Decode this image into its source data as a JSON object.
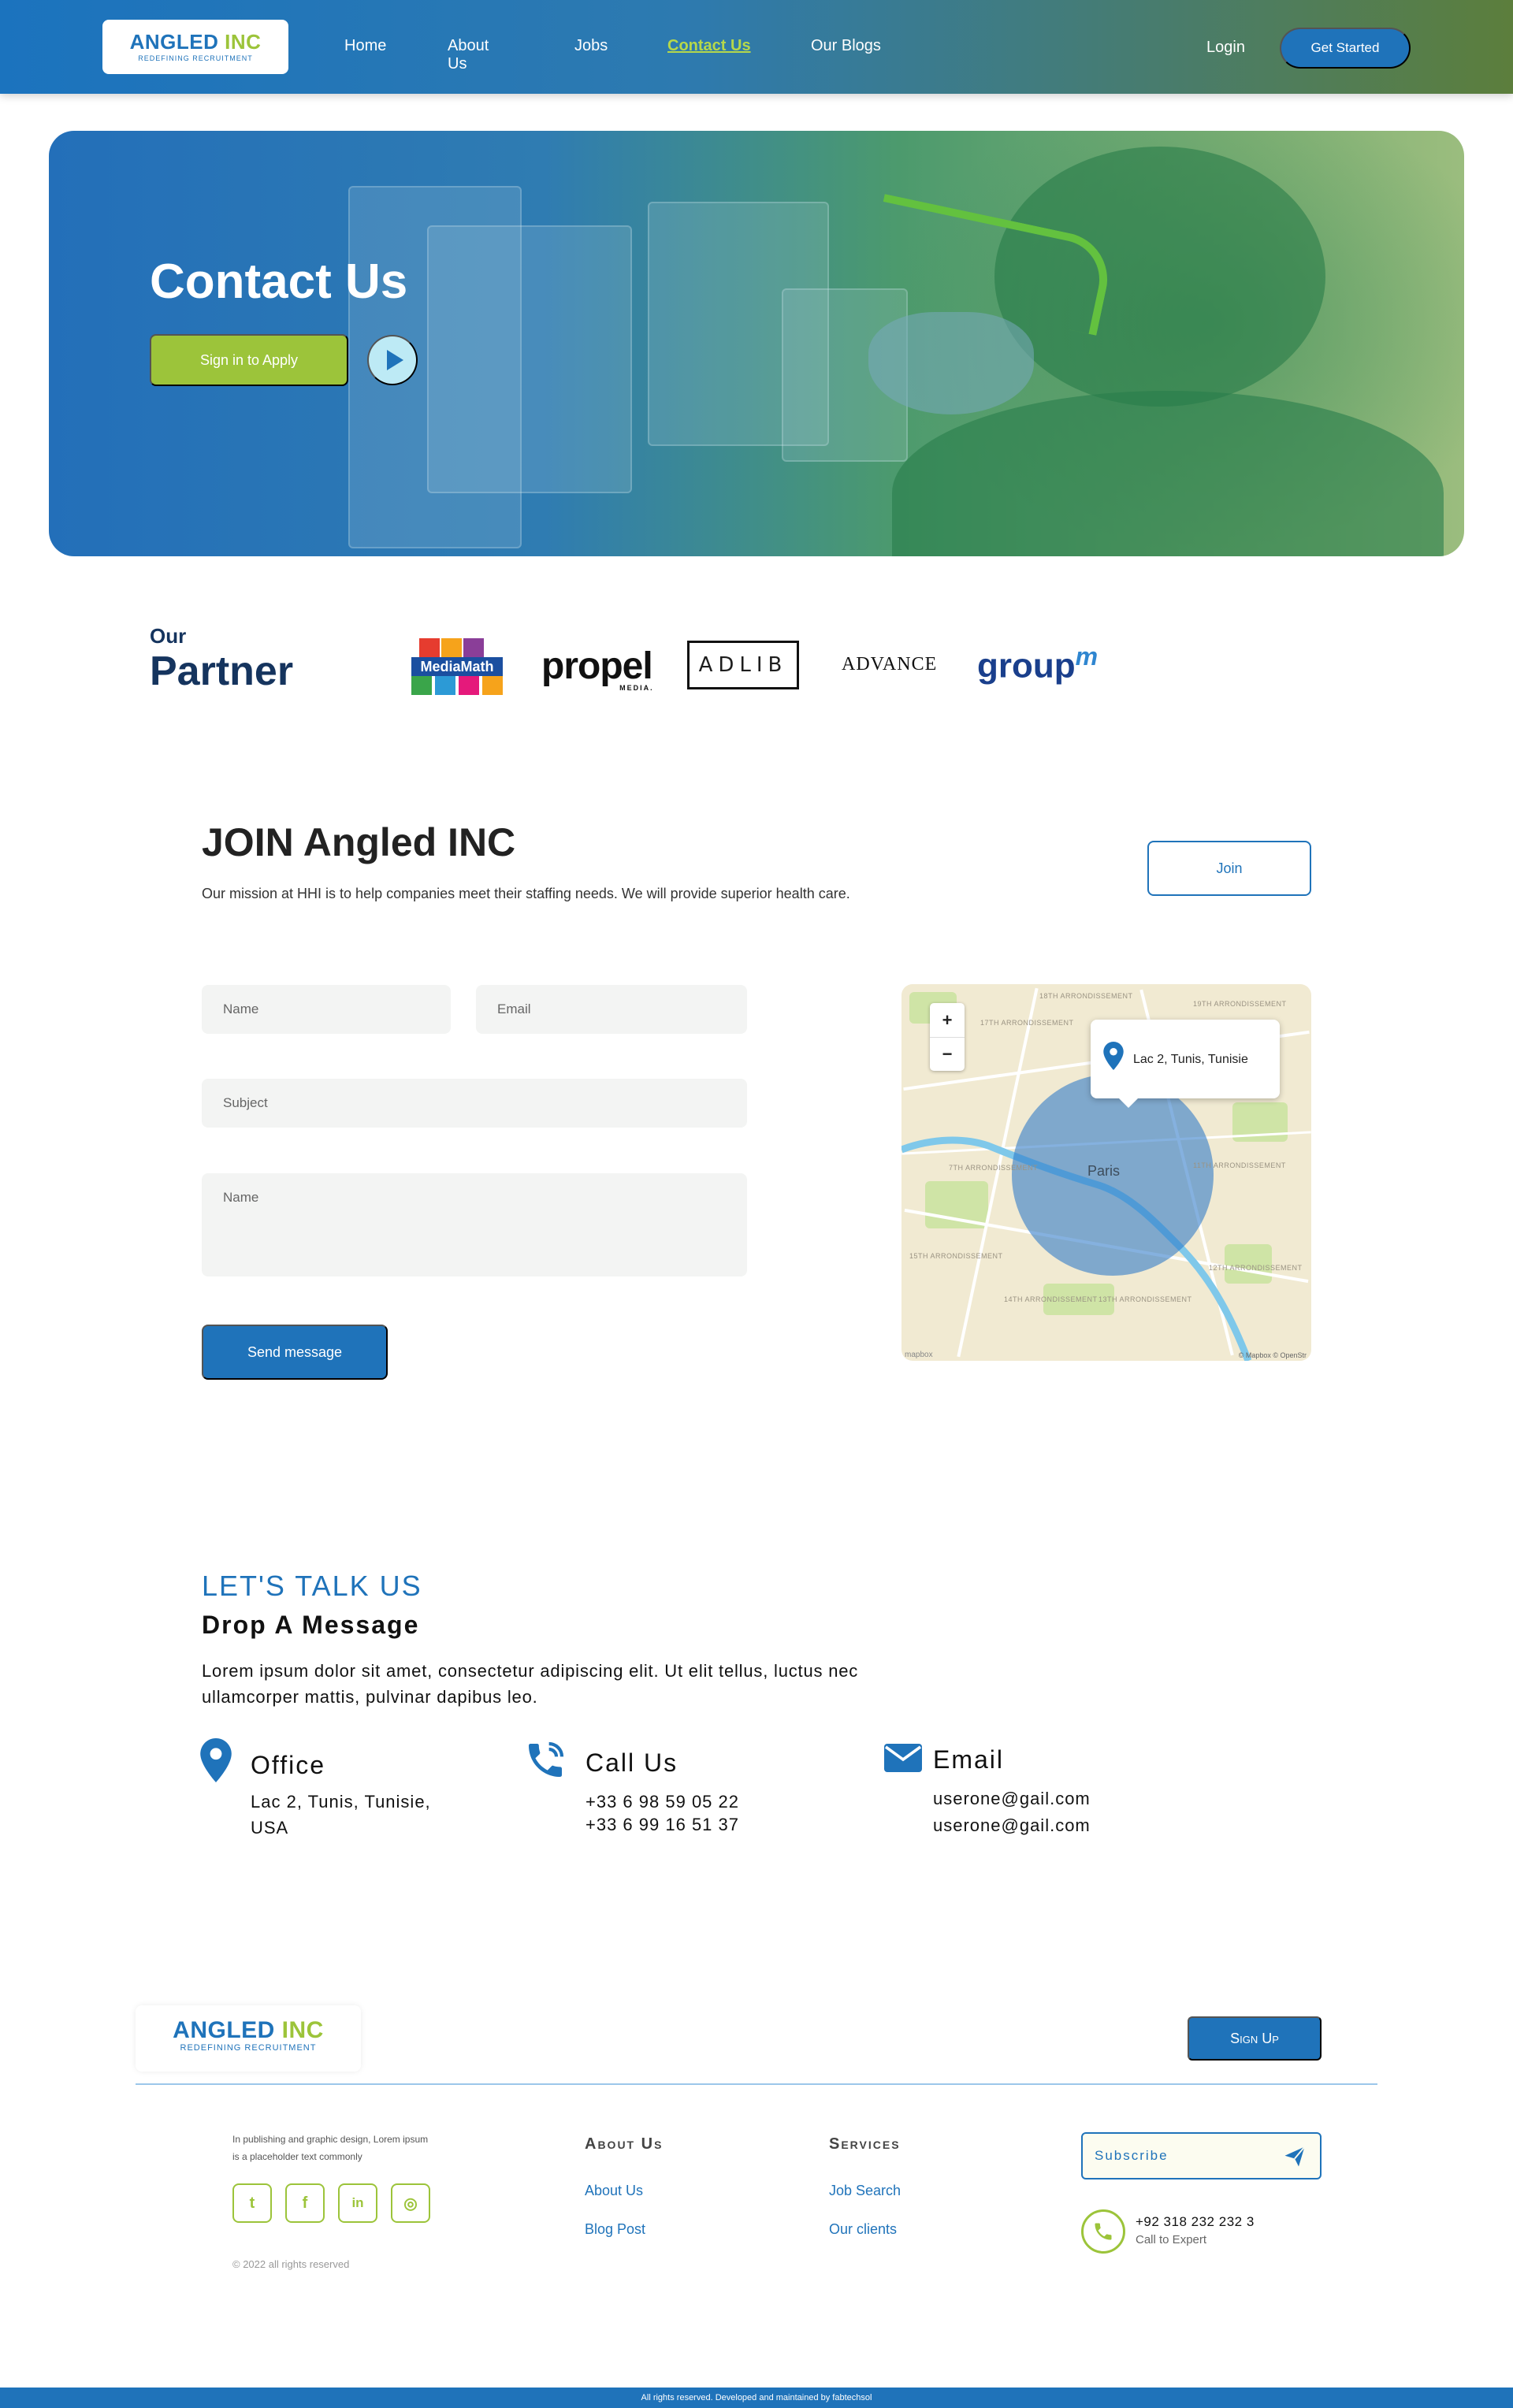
{
  "brand": {
    "name_main": "ANGLED",
    "name_accent": "INC",
    "tagline": "REDEFINING RECRUITMENT"
  },
  "nav": {
    "links": [
      {
        "label": "Home",
        "active": false
      },
      {
        "label": "About Us",
        "active": false
      },
      {
        "label": "Jobs",
        "active": false
      },
      {
        "label": "Contact Us",
        "active": true
      },
      {
        "label": "Our Blogs",
        "active": false
      }
    ],
    "login": "Login",
    "cta": "Get Started"
  },
  "hero": {
    "title": "Contact Us",
    "button": "Sign in to Apply",
    "play_icon": "play-icon"
  },
  "partners": {
    "kicker": "Our",
    "title": "Partner",
    "logos": {
      "mediamath": "MediaMath",
      "propel": "propel",
      "propel_sub": "MEDIA.",
      "adlib": "ADLIB",
      "advance": "ADVANCE",
      "groupm": "group",
      "groupm_sup": "m"
    }
  },
  "join": {
    "title": "JOIN Angled INC",
    "description": "Our mission at HHI is to help companies meet their staffing needs. We will provide superior health care.",
    "button": "Join",
    "form": {
      "name_placeholder": "Name",
      "email_placeholder": "Email",
      "subject_placeholder": "Subject",
      "message_placeholder": "Name",
      "submit": "Send message"
    }
  },
  "map": {
    "city": "Paris",
    "popup_address": "Lac 2, Tunis, Tunisie",
    "zoom_in": "+",
    "zoom_out": "−",
    "attribution": "© Mapbox © OpenStr",
    "brand": "mapbox",
    "districts": [
      "18TH ARRONDISSEMENT",
      "17TH ARRONDISSEMENT",
      "19TH ARRONDISSEMENT",
      "7TH ARRONDISSEMENT",
      "11TH ARRONDISSEMENT",
      "15TH ARRONDISSEMENT",
      "14TH ARRONDISSEMENT",
      "13TH ARRONDISSEMENT",
      "12TH ARRONDISSEMENT"
    ],
    "colors": {
      "land": "#f1ead2",
      "water": "#7fc8ea",
      "park": "#cfe4a6",
      "radius": "#2c78c8"
    }
  },
  "talk": {
    "kicker": "LET'S TALK US",
    "title": "Drop A Message",
    "description": "Lorem ipsum dolor sit amet, consectetur adipiscing elit. Ut elit tellus, luctus nec ullamcorper mattis, pulvinar dapibus leo.",
    "office": {
      "title": "Office",
      "line1": "Lac 2, Tunis, Tunisie,",
      "line2": "USA",
      "icon": "location-pin-icon"
    },
    "call": {
      "title": "Call Us",
      "line1": "+33 6 98 59 05 22",
      "line2": "+33 6 99 16 51 37",
      "icon": "phone-icon"
    },
    "email": {
      "title": "Email",
      "line1": "userone@gail.com",
      "line2": "userone@gail.com",
      "icon": "envelope-icon"
    }
  },
  "footer": {
    "signup": "Sign Up",
    "about_text": "In publishing and graphic design, Lorem ipsum is a placeholder text commonly",
    "social": [
      {
        "name": "twitter-icon",
        "glyph": "t"
      },
      {
        "name": "facebook-icon",
        "glyph": "f"
      },
      {
        "name": "linkedin-icon",
        "glyph": "in"
      },
      {
        "name": "instagram-icon",
        "glyph": "◎"
      }
    ],
    "copyright": "© 2022 all rights reserved",
    "col1": {
      "title": "About Us",
      "links": [
        "About Us",
        "Blog Post"
      ]
    },
    "col2": {
      "title": "Services",
      "links": [
        "Job Search",
        "Our clients"
      ]
    },
    "subscribe": "Subscribe",
    "phone": "+92 318 232 232 3",
    "phone_sub": "Call to Expert",
    "bottom": "All rights reserved. Developed and maintained by fabtechsol"
  },
  "colors": {
    "primary": "#1f73ba",
    "accent": "#9cc43a",
    "dark_navy": "#15345e"
  }
}
